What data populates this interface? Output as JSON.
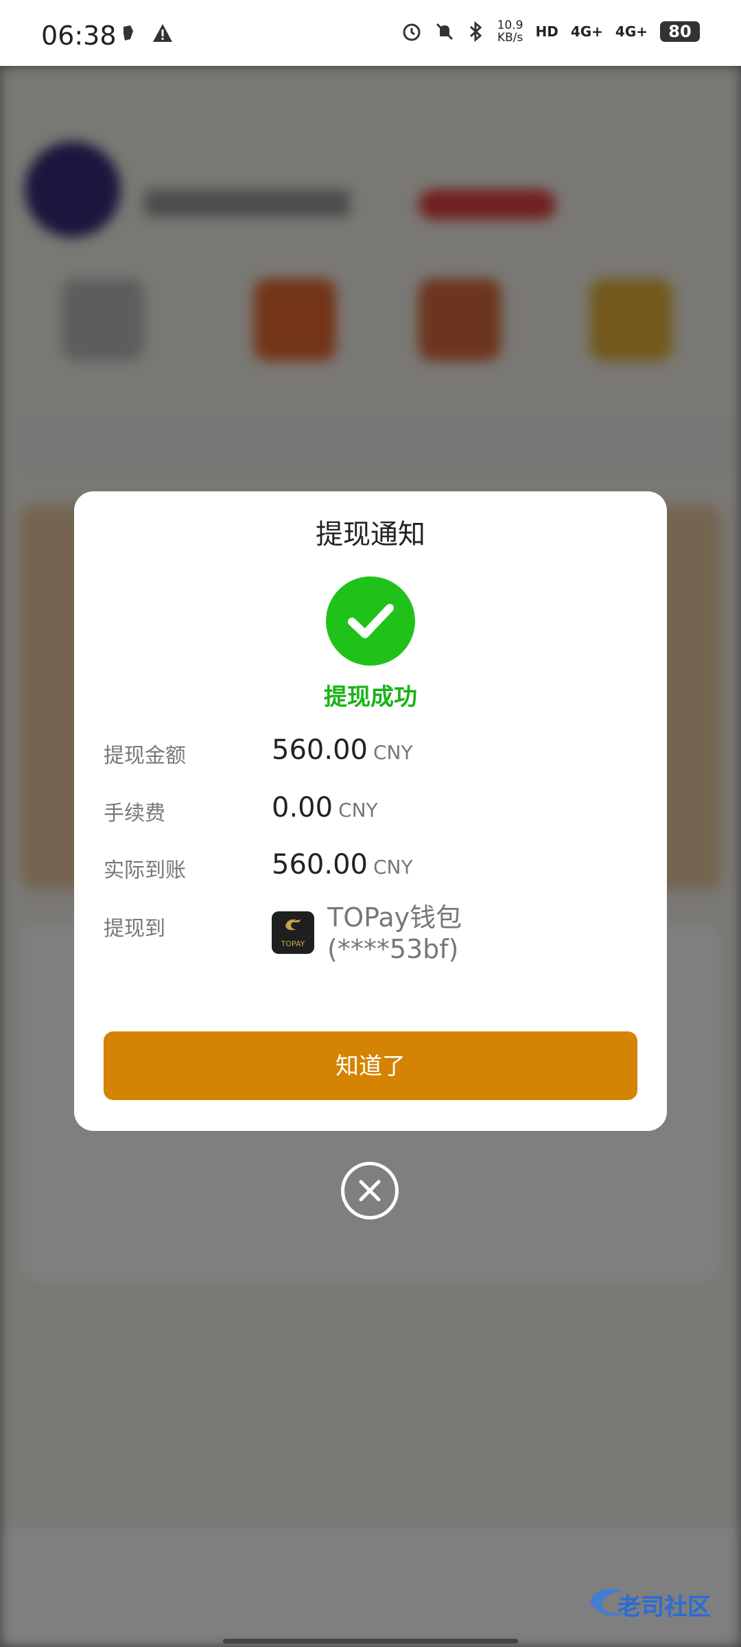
{
  "status_bar": {
    "time": "06:38",
    "net_speed_value": "10.9",
    "net_speed_unit": "KB/s",
    "hd_label": "HD",
    "signal1": "4G+",
    "signal2": "4G+",
    "battery": "80",
    "icons": [
      "alarm-icon",
      "mute-icon",
      "bluetooth-icon",
      "warning-icon"
    ]
  },
  "dialog": {
    "title": "提现通知",
    "success_text": "提现成功",
    "rows": [
      {
        "label": "提现金额",
        "amount": "560.00",
        "unit": "CNY"
      },
      {
        "label": "手续费",
        "amount": "0.00",
        "unit": "CNY"
      },
      {
        "label": "实际到账",
        "amount": "560.00",
        "unit": "CNY"
      }
    ],
    "destination_label": "提现到",
    "wallet_name": "TOPay钱包",
    "wallet_account": "(****53bf)",
    "wallet_logo_text": "TOPAY",
    "ok_button": "知道了"
  },
  "watermark_text": "老司社区",
  "colors": {
    "accent": "#d48302",
    "success": "#20c21a",
    "overlay": "rgba(0,0,0,0.5)"
  }
}
